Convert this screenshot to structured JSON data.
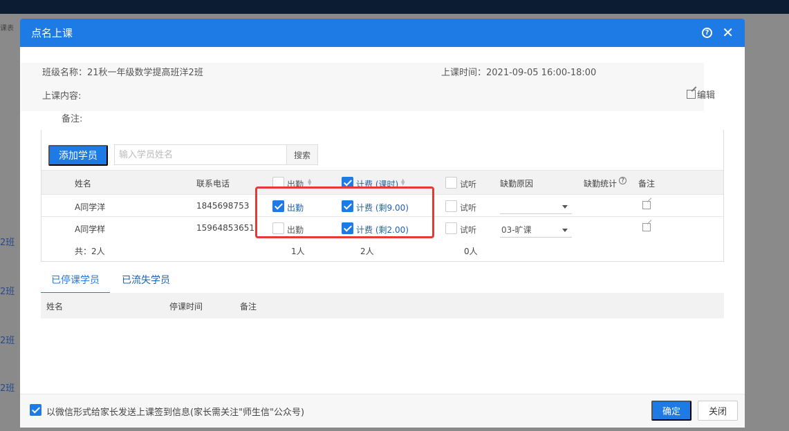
{
  "background": {
    "crumb": "课表",
    "side_links": [
      "2班",
      "2班",
      "2班",
      "2班"
    ]
  },
  "modal": {
    "title": "点名上课",
    "info": {
      "class_name": "班级名称：21秋一年级数学提高班洋2班",
      "class_time": "上课时间：2021-09-05    16:00-18:00",
      "content_label": "上课内容:",
      "remark_label": "备注:",
      "edit_label": "编辑"
    },
    "toolbar": {
      "add_label": "添加学员",
      "search_placeholder": "输入学员姓名",
      "search_label": "搜索"
    },
    "table": {
      "headers": {
        "name": "姓名",
        "phone": "联系电话",
        "attend": "出勤",
        "fee": "计费 (课时)",
        "trial": "试听",
        "absence_reason": "缺勤原因",
        "absence_stats": "缺勤统计",
        "remark": "备注"
      },
      "rows": [
        {
          "name": "A同学洋",
          "phone": "1845698753",
          "attend_label": "出勤",
          "attend": true,
          "fee_label": "计费 (剩9.00)",
          "fee": true,
          "trial_label": "试听",
          "trial": false,
          "reason": ""
        },
        {
          "name": "A同学样",
          "phone": "15964853651",
          "attend_label": "出勤",
          "attend": false,
          "fee_label": "计费 (剩2.00)",
          "fee": true,
          "trial_label": "试听",
          "trial": false,
          "reason": "03-旷课"
        }
      ],
      "summary": {
        "total": "共：2人",
        "attend": "1人",
        "fee": "2人",
        "trial": "0人"
      }
    },
    "tabs": [
      {
        "label": "已停课学员",
        "active": true
      },
      {
        "label": "已流失学员",
        "active": false
      }
    ],
    "sub_headers": {
      "name": "姓名",
      "time": "停课时间",
      "remark": "备注"
    },
    "footer": {
      "wechat_label": "以微信形式给家长发送上课签到信息(家长需关注\"师生信\"公众号)",
      "wechat_checked": true,
      "ok_label": "确定",
      "close_label": "关闭"
    }
  },
  "colors": {
    "primary": "#1e7be6",
    "highlight": "#e53935"
  },
  "icons": {
    "help": "question-circle-icon",
    "close": "close-icon",
    "edit": "edit-icon",
    "sort": "sort-icon",
    "dropdown": "chevron-down-icon"
  }
}
